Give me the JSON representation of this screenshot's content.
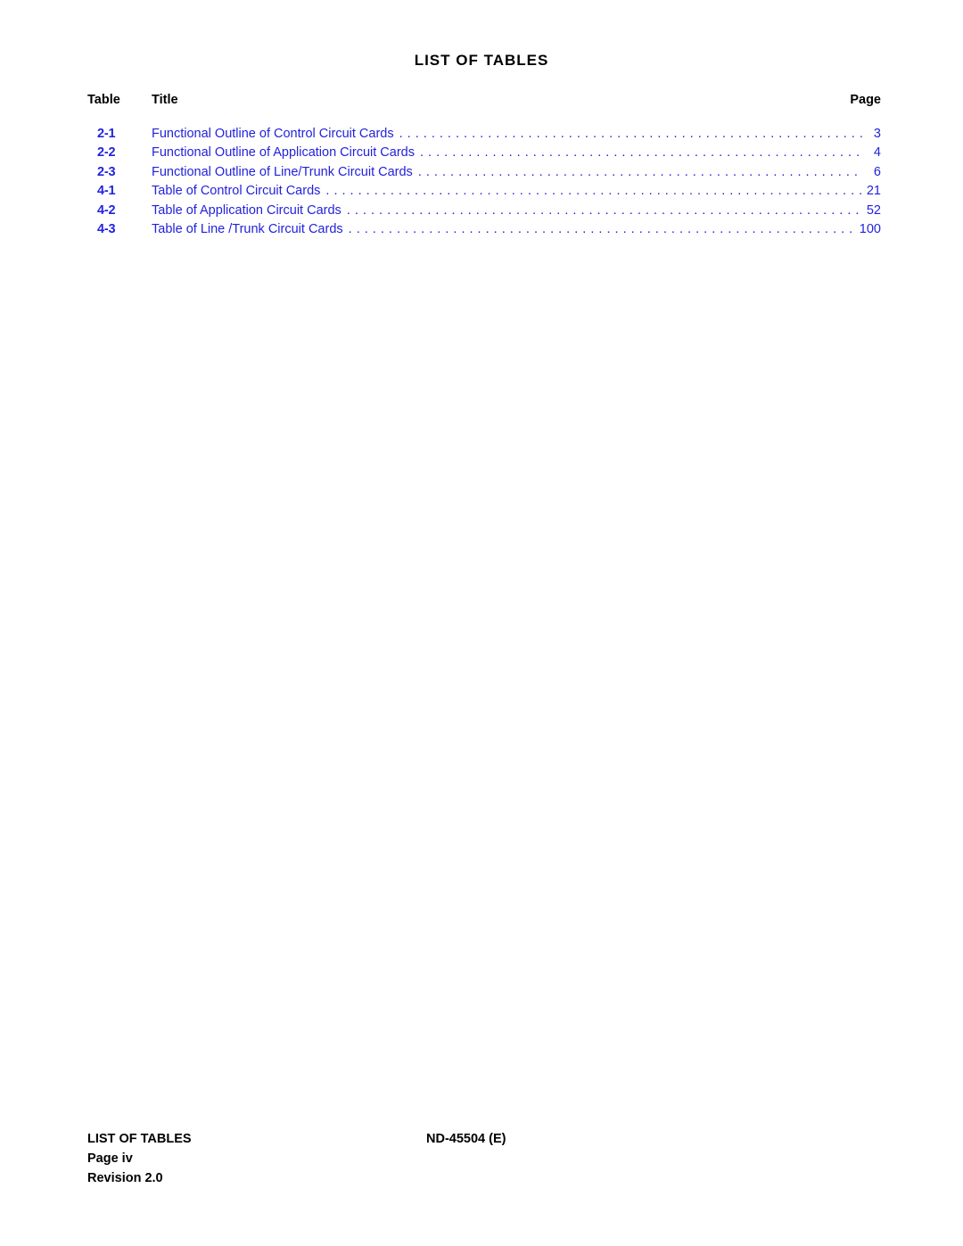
{
  "document": {
    "title": "LIST OF TABLES",
    "accent_color": "#2222dd",
    "text_color": "#000000"
  },
  "columns": {
    "table_header": "Table",
    "title_header": "Title",
    "page_header": "Page"
  },
  "entries": [
    {
      "number": "2-1",
      "title": "Functional Outline of Control Circuit Cards",
      "page": "3"
    },
    {
      "number": "2-2",
      "title": "Functional Outline of Application Circuit Cards",
      "page": "4"
    },
    {
      "number": "2-3",
      "title": "Functional Outline of Line/Trunk Circuit Cards",
      "page": "6"
    },
    {
      "number": "4-1",
      "title": "Table of Control Circuit Cards",
      "page": "21"
    },
    {
      "number": "4-2",
      "title": "Table of Application Circuit Cards",
      "page": "52"
    },
    {
      "number": "4-3",
      "title": "Table of Line /Trunk Circuit Cards",
      "page": "100"
    }
  ],
  "footer": {
    "section": "LIST OF TABLES",
    "doc_number": "ND-45504 (E)",
    "page_label": "Page iv",
    "revision": "Revision 2.0"
  }
}
